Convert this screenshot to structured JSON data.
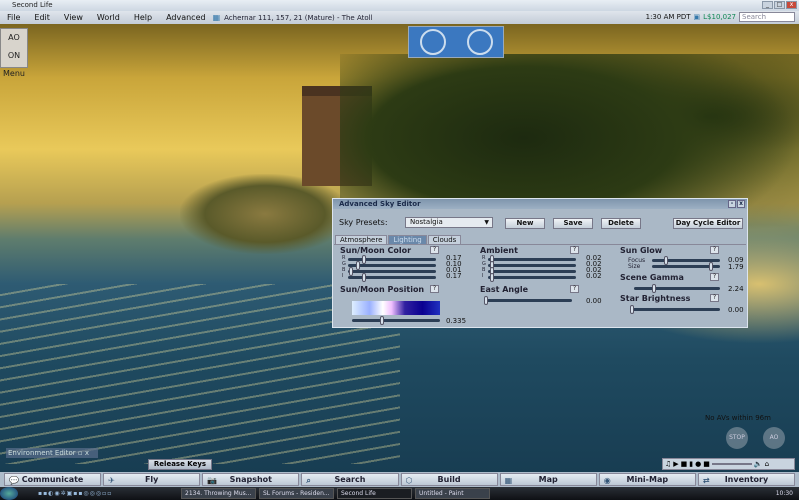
{
  "window": {
    "title": "Second Life"
  },
  "menu": {
    "items": [
      "File",
      "Edit",
      "View",
      "World",
      "Help",
      "Advanced"
    ],
    "location": "Achernar 111, 157, 21 (Mature) - The Atoll",
    "time": "1:30 AM PDT",
    "balance": "L$10,027",
    "search_placeholder": "Search"
  },
  "hud": {
    "ao_label": "AO ON",
    "menu_label": "Menu"
  },
  "sky_editor": {
    "title": "Advanced Sky Editor",
    "presets_label": "Sky Presets:",
    "preset_value": "Nostalgia",
    "buttons": {
      "new": "New",
      "save": "Save",
      "delete": "Delete",
      "day_cycle": "Day Cycle Editor"
    },
    "tabs": [
      "Atmosphere",
      "Lighting",
      "Clouds"
    ],
    "active_tab": 1,
    "sun_moon_color": {
      "label": "Sun/Moon Color",
      "channels": [
        {
          "ch": "R",
          "value": "0.17"
        },
        {
          "ch": "G",
          "value": "0.10"
        },
        {
          "ch": "B",
          "value": "0.01"
        },
        {
          "ch": "I",
          "value": "0.17"
        }
      ]
    },
    "ambient": {
      "label": "Ambient",
      "channels": [
        {
          "ch": "R",
          "value": "0.02"
        },
        {
          "ch": "G",
          "value": "0.02"
        },
        {
          "ch": "B",
          "value": "0.02"
        },
        {
          "ch": "I",
          "value": "0.02"
        }
      ]
    },
    "sun_moon_position": {
      "label": "Sun/Moon Position",
      "value": "0.335"
    },
    "east_angle": {
      "label": "East Angle",
      "value": "0.00"
    },
    "sun_glow": {
      "label": "Sun Glow",
      "focus_label": "Focus",
      "focus": "0.09",
      "size_label": "Size",
      "size": "1.79"
    },
    "scene_gamma": {
      "label": "Scene Gamma",
      "value": "2.24"
    },
    "star_brightness": {
      "label": "Star Brightness",
      "value": "0.00"
    },
    "help_glyph": "?"
  },
  "overlay": {
    "environment_editor": "Environment Editor",
    "release_keys": "Release Keys",
    "no_avs": "No AVs within 96m",
    "stop_flying": "STOP",
    "ao": "AO"
  },
  "toolbar": [
    "Communicate",
    "Fly",
    "Snapshot",
    "Search",
    "Build",
    "Map",
    "Mini-Map",
    "Inventory"
  ],
  "taskbar": {
    "tasks": [
      "2134. Throwing Mus...",
      "SL Forums - Residen...",
      "Second Life",
      "Untitled - Paint"
    ],
    "active": 2,
    "clock": "10:30"
  }
}
